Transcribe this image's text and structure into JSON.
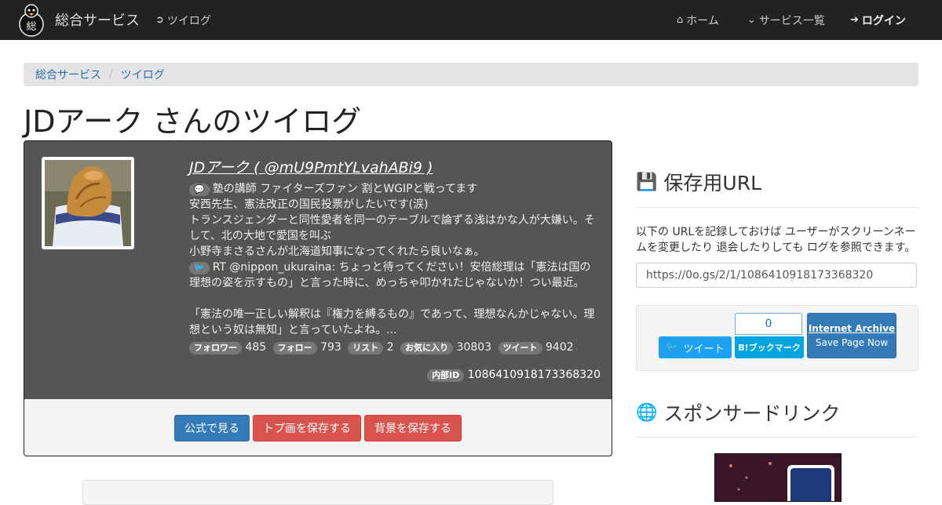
{
  "nav": {
    "brand": "総合サービス",
    "twilog": "ツイログ",
    "home": "ホーム",
    "services": "サービス一覧",
    "login": "ログイン"
  },
  "breadcrumb": [
    "総合サービス",
    "ツイログ"
  ],
  "page_title": "JDアーク さんのツイログ",
  "profile": {
    "name": "JDアーク ( @mU9PmtYLvahABi9 )",
    "bio_lines": [
      "塾の講師 ファイターズファン 割とWGIPと戦ってます",
      "安西先生、憲法改正の国民投票がしたいです(涙)",
      "トランスジェンダーと同性愛者を同一のテーブルで論ずる浅はかな人が大嫌い。そして、北の大地で愛国を叫ぶ",
      "小野寺まさるさんが北海道知事になってくれたら良いなぁ。"
    ],
    "tweet_lines": [
      "RT @nippon_ukuraina: ちょっと待ってください！安倍総理は「憲法は国の理想の姿を示すもの」と言った時に、めっちゃ叩かれたじゃないか！つい最近。",
      "「憲法の唯一正しい解釈は『権力を縛るもの』であって、理想なんかじゃない。理想という奴は無知」と言っていたよね。..."
    ],
    "stats": [
      {
        "label": "フォロワー",
        "value": "485"
      },
      {
        "label": "フォロー",
        "value": "793"
      },
      {
        "label": "リスト",
        "value": "2"
      },
      {
        "label": "お気に入り",
        "value": "30803"
      },
      {
        "label": "ツイート",
        "value": "9402"
      }
    ],
    "internal_id_label": "内部ID",
    "internal_id": "1086410918173368320"
  },
  "actions": {
    "official": "公式で見る",
    "save_avatar": "トプ画を保存する",
    "save_bg": "背景を保存する"
  },
  "sidebar": {
    "save_url_heading": "保存用URL",
    "save_url_desc": "以下の URLを記録しておけば ユーザーがスクリーンネームを変更したり 退会したりしても ログを参照できます。",
    "save_url_value": "https://0o.gs/2/1/1086410918173368320",
    "tweet_button": "ツイート",
    "hatena_count": "0",
    "hatena_button": "B!ブックマーク",
    "ia_title": "Internet Archive",
    "ia_sub": "Save Page Now",
    "sponsor_heading": "スポンサードリンク"
  },
  "colors": {
    "navbar": "#222222",
    "primary": "#337ab7",
    "danger": "#d9534f",
    "twitter": "#1da1f2",
    "hatena": "#00a4de"
  }
}
